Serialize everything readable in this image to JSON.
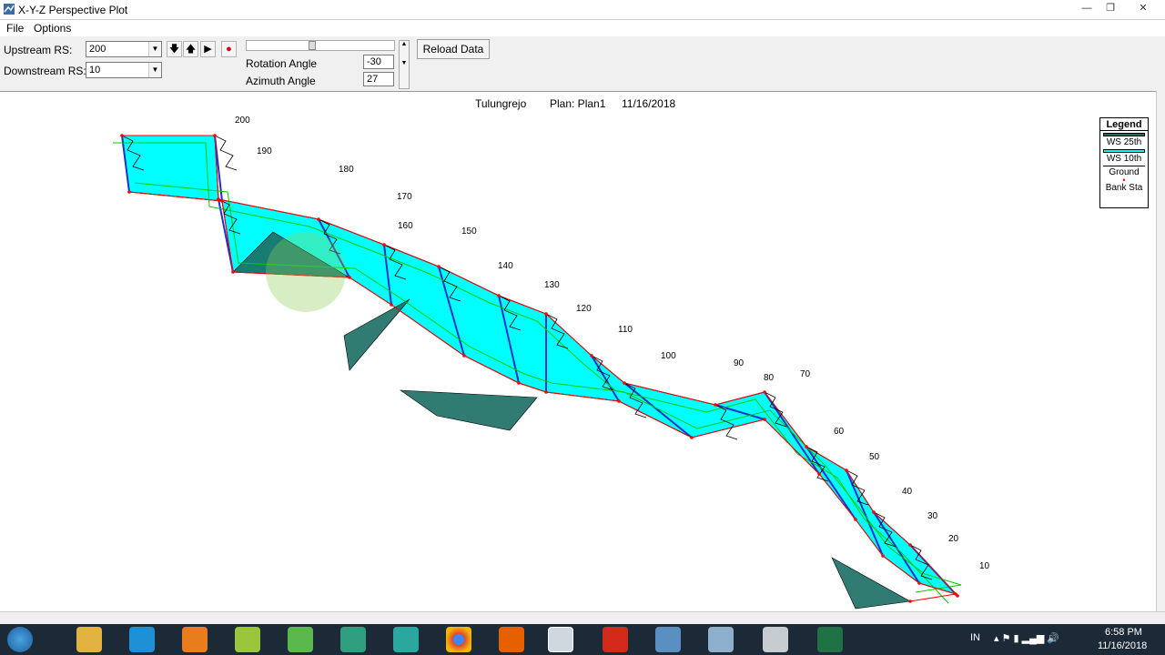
{
  "window": {
    "title": "X-Y-Z Perspective Plot"
  },
  "menu": {
    "file": "File",
    "options": "Options"
  },
  "toolbar": {
    "upstream_label": "Upstream RS:",
    "upstream_value": "200",
    "downstream_label": "Downstream RS:",
    "downstream_value": "10",
    "rotation_label": "Rotation Angle",
    "rotation_value": "-30",
    "azimuth_label": "Azimuth Angle",
    "azimuth_value": "27",
    "reload_label": "Reload Data"
  },
  "plot": {
    "river": "Tulungrejo",
    "plan": "Plan: Plan1",
    "date": "11/16/2018",
    "stations": [
      "200",
      "190",
      "180",
      "170",
      "160",
      "150",
      "140",
      "130",
      "120",
      "110",
      "100",
      "90",
      "80",
      "70",
      "60",
      "50",
      "40",
      "30",
      "20",
      "10"
    ]
  },
  "legend": {
    "title": "Legend",
    "ws25": "WS 25th",
    "ws10": "WS 10th",
    "ground": "Ground",
    "bank": "Bank Sta",
    "ws25_color": "#1a6e64",
    "ws10_color": "#00ffff",
    "ground_color": "#000000",
    "bank_color": "#ff0000"
  },
  "taskbar": {
    "lang": "IN",
    "time": "6:58 PM",
    "date": "11/16/2018"
  }
}
